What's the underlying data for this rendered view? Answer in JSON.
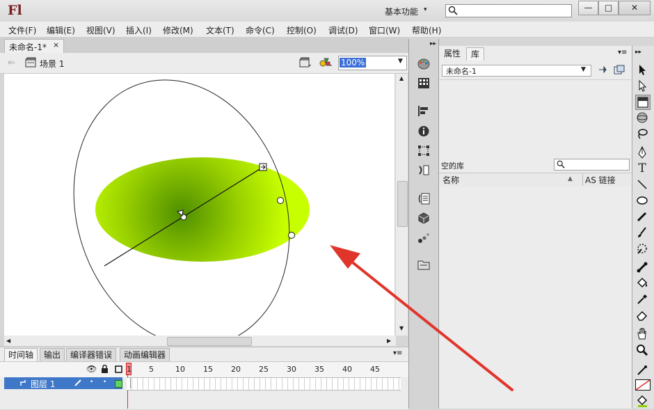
{
  "app": {
    "logo": "Fl",
    "workspace": "基本功能",
    "workspace_arrow": "▾"
  },
  "window_buttons": {
    "minimize": "—",
    "maximize": "□",
    "close": "✕"
  },
  "menu": [
    "文件(F)",
    "编辑(E)",
    "视图(V)",
    "插入(I)",
    "修改(M)",
    "文本(T)",
    "命令(C)",
    "控制(O)",
    "调试(D)",
    "窗口(W)",
    "帮助(H)"
  ],
  "document": {
    "tab_label": "未命名-1*",
    "tab_close": "×",
    "scene_label": "场景 1",
    "zoom": "100%"
  },
  "timeline": {
    "tabs": [
      "时间轴",
      "输出",
      "编译器错误",
      "动画编辑器"
    ],
    "frame_numbers": [
      "1",
      "5",
      "10",
      "15",
      "20",
      "25",
      "30",
      "35",
      "40",
      "45"
    ],
    "layer_name": "图层 1"
  },
  "library": {
    "tabs": [
      "属性",
      "库"
    ],
    "document_select": "未命名-1",
    "item_count": "空的库",
    "col_name": "名称",
    "col_linkage": "AS 链接"
  },
  "colors": {
    "fill_center": "#4f8f00",
    "fill_edge": "#c8ff00",
    "arrow": "#e0352b",
    "layer_highlight": "#3f78c8"
  }
}
